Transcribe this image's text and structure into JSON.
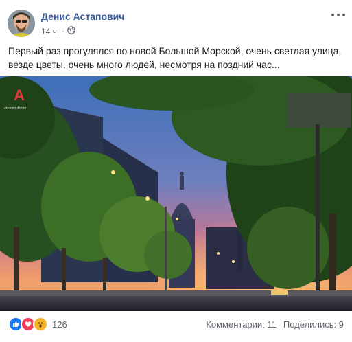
{
  "post": {
    "author": "Денис Астапович",
    "time": "14 ч.",
    "separator": "·",
    "text": "Первый раз прогулялся по новой Большой Морской, очень светлая улица, везде цветы, очень много людей, несмотря на поздний час...",
    "photo_watermark": "vk.com/ufsfoto",
    "reactions": {
      "icons": [
        "like-icon",
        "love-icon",
        "wow-icon"
      ],
      "count": "126"
    },
    "comments_label": "Комментарии: 11",
    "shares_label": "Поделились: 9"
  },
  "colors": {
    "author_link": "#385898",
    "like": "#1877f2",
    "love": "#f33e58",
    "wow": "#f7b125",
    "meta_text": "#616770"
  }
}
